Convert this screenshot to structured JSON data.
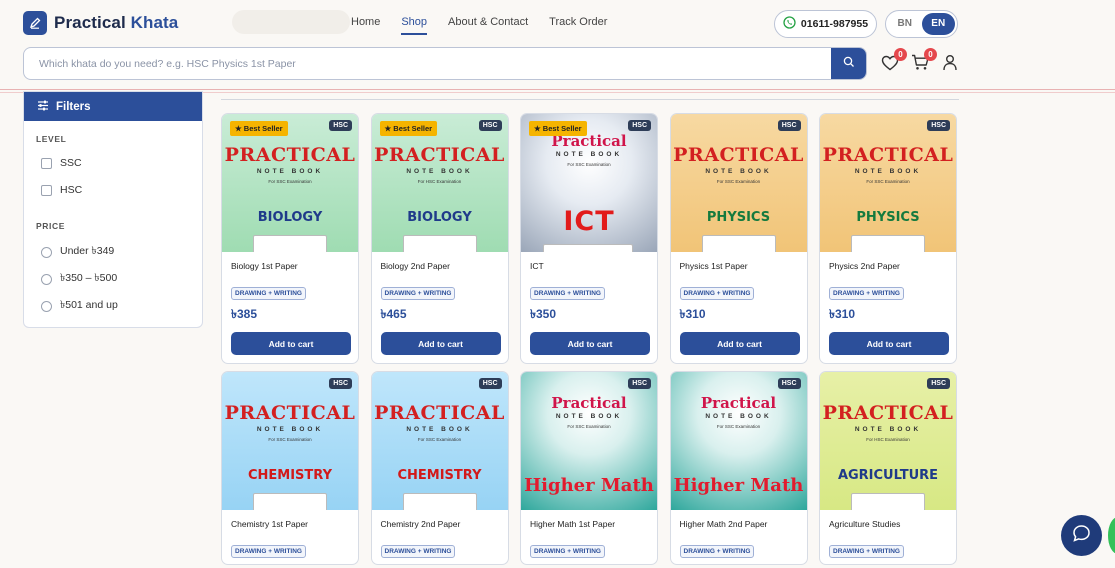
{
  "brand": {
    "name_part1": "Practical ",
    "name_part2": "Khata"
  },
  "nav": {
    "home": "Home",
    "shop": "Shop",
    "about": "About & Contact",
    "track": "Track Order"
  },
  "phone": "01611-987955",
  "lang": {
    "bn": "BN",
    "en": "EN",
    "active": "EN"
  },
  "search": {
    "placeholder": "Which khata do you need? e.g. HSC Physics 1st Paper",
    "value": ""
  },
  "wishlist": {
    "count": "0"
  },
  "cart": {
    "count": "0"
  },
  "filters": {
    "title": "Filters",
    "level_label": "LEVEL",
    "levels": [
      "SSC",
      "HSC"
    ],
    "price_label": "PRICE",
    "prices": [
      "Under ৳349",
      "৳350 – ৳500",
      "৳501 and up"
    ]
  },
  "colors": {
    "primary": "#2c4f9a",
    "best_seller": "#f5b400",
    "badge_red": "#e5484d"
  },
  "products": [
    {
      "name": "Biology 1st Paper",
      "level": "HSC",
      "best": "★ Best Seller",
      "tag": "DRAWING + WRITING",
      "price": "৳385",
      "cta": "Add to cart",
      "subject": "BIOLOGY",
      "art": "PRACTICAL",
      "sub": "NOTE BOOK",
      "sub2": "For SSC Examination"
    },
    {
      "name": "Biology 2nd Paper",
      "level": "HSC",
      "best": "★ Best Seller",
      "tag": "DRAWING + WRITING",
      "price": "৳465",
      "cta": "Add to cart",
      "subject": "BIOLOGY",
      "art": "PRACTICAL",
      "sub": "NOTE BOOK",
      "sub2": "For HSC Examination"
    },
    {
      "name": "ICT",
      "level": "HSC",
      "best": "★ Best Seller",
      "tag": "DRAWING + WRITING",
      "price": "৳350",
      "cta": "Add to cart",
      "subject": "ICT",
      "art": "Practical",
      "sub": "NOTE BOOK",
      "sub2": "For SSC Examination"
    },
    {
      "name": "Physics 1st Paper",
      "level": "HSC",
      "best": "",
      "tag": "DRAWING + WRITING",
      "price": "৳310",
      "cta": "Add to cart",
      "subject": "PHYSICS",
      "art": "PRACTICAL",
      "sub": "NOTE BOOK",
      "sub2": "For SSC Examination"
    },
    {
      "name": "Physics 2nd Paper",
      "level": "HSC",
      "best": "",
      "tag": "DRAWING + WRITING",
      "price": "৳310",
      "cta": "Add to cart",
      "subject": "PHYSICS",
      "art": "PRACTICAL",
      "sub": "NOTE BOOK",
      "sub2": "For SSC Examination"
    },
    {
      "name": "Chemistry 1st Paper",
      "level": "HSC",
      "best": "",
      "tag": "DRAWING + WRITING",
      "price": "",
      "cta": "",
      "subject": "CHEMISTRY",
      "art": "PRACTICAL",
      "sub": "NOTE BOOK",
      "sub2": "For SSC Examination"
    },
    {
      "name": "Chemistry 2nd Paper",
      "level": "HSC",
      "best": "",
      "tag": "DRAWING + WRITING",
      "price": "",
      "cta": "",
      "subject": "CHEMISTRY",
      "art": "PRACTICAL",
      "sub": "NOTE BOOK",
      "sub2": "For SSC Examination"
    },
    {
      "name": "Higher Math 1st Paper",
      "level": "HSC",
      "best": "",
      "tag": "DRAWING + WRITING",
      "price": "",
      "cta": "",
      "subject": "Higher Math",
      "art": "Practical",
      "sub": "NOTE BOOK",
      "sub2": "For SSC Examination"
    },
    {
      "name": "Higher Math 2nd Paper",
      "level": "HSC",
      "best": "",
      "tag": "DRAWING + WRITING",
      "price": "",
      "cta": "",
      "subject": "Higher Math",
      "art": "Practical",
      "sub": "NOTE BOOK",
      "sub2": "For SSC Examination"
    },
    {
      "name": "Agriculture Studies",
      "level": "HSC",
      "best": "",
      "tag": "DRAWING + WRITING",
      "price": "",
      "cta": "",
      "subject": "AGRICULTURE",
      "art": "PRACTICAL",
      "sub": "NOTE BOOK",
      "sub2": "For HSC Examination"
    }
  ]
}
